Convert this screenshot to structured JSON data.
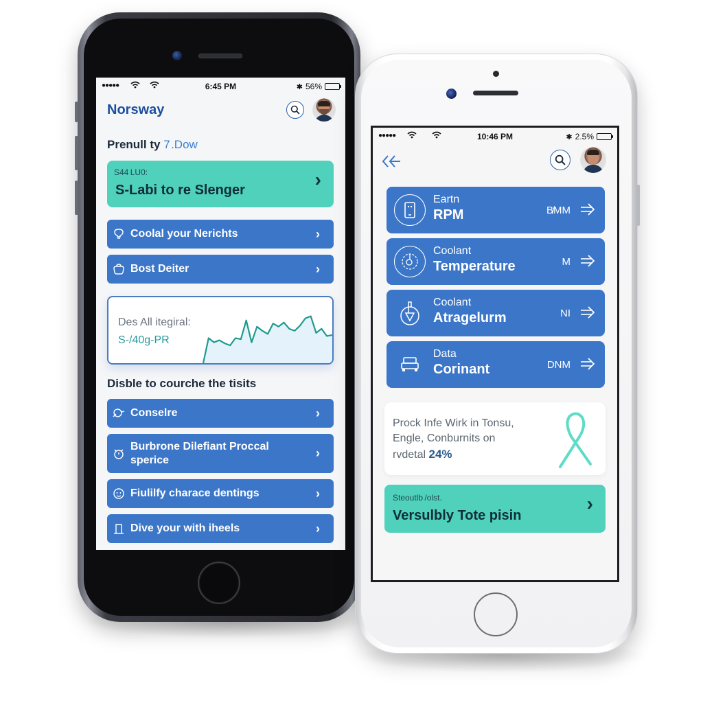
{
  "left_phone": {
    "status_bar": {
      "signal": "●●●●●",
      "time": "6:45 PM",
      "battery_percent": "56%",
      "battery_level": 0.56
    },
    "header": {
      "brand": "Norsway",
      "search_icon": "search-icon",
      "avatar": "user-avatar"
    },
    "subtitle": {
      "main": "Prenull ty",
      "accent": "7 .Dow"
    },
    "promo_card": {
      "small": "S44 LU0:",
      "title": "S-Labi to re Slenger",
      "chevron": "›"
    },
    "top_items": [
      {
        "icon": "lightbulb-icon",
        "label": "Coolal your Nerichts"
      },
      {
        "icon": "bag-icon",
        "label": "Bost Deiter"
      }
    ],
    "chart_card": {
      "title": "Des All itegiral:",
      "value": "S-/40g-PR"
    },
    "chart_data": {
      "type": "area",
      "title": "Des All itegiral:",
      "xlabel": "",
      "ylabel": "",
      "x": [
        0,
        1,
        2,
        3,
        4,
        5,
        6,
        7,
        8,
        9,
        10,
        11,
        12,
        13,
        14,
        15,
        16,
        17,
        18,
        19,
        20,
        21,
        22,
        23,
        24
      ],
      "values": [
        0,
        48,
        40,
        44,
        38,
        34,
        48,
        46,
        82,
        40,
        70,
        62,
        56,
        76,
        70,
        78,
        66,
        62,
        72,
        86,
        90,
        58,
        66,
        52,
        54
      ],
      "ylim": [
        0,
        100
      ],
      "grid": false,
      "line_color": "#1f9a8a",
      "fill_color": "#e4f2fb"
    },
    "section_title": "Disble to courche the tisits",
    "list_items": [
      {
        "icon": "pot-icon",
        "label": "Conselre"
      },
      {
        "icon": "alarm-clock-icon",
        "label": "Burbrone Dilefiant Proccal sperice"
      },
      {
        "icon": "face-icon",
        "label": "Fiulilfy charace dentings"
      },
      {
        "icon": "door-icon",
        "label": "Dive your with iheels"
      }
    ]
  },
  "right_phone": {
    "status_bar": {
      "signal": "●●●●●",
      "time": "10:46 PM",
      "battery_percent": "2.5%",
      "battery_level": 0.9
    },
    "header": {
      "back_icon": "double-chevron-left-icon",
      "search_icon": "search-icon",
      "avatar": "user-avatar"
    },
    "metrics": [
      {
        "icon": "phone-icon",
        "top": "Eartn",
        "bottom": "RPM",
        "unit": "B̸MM"
      },
      {
        "icon": "gauge-icon",
        "top": "Coolant",
        "bottom": "Temperature",
        "unit": "M"
      },
      {
        "icon": "thermometer-icon",
        "top": "Coolant",
        "bottom": "Atragelurm",
        "unit": "NI"
      },
      {
        "icon": "car-icon",
        "top": "Data",
        "bottom": "Corinant",
        "unit": "DNM"
      }
    ],
    "info_card": {
      "line1": "Prock Infe Wirk in Tonsu,",
      "line2": "Engle, Conburnits on",
      "line3_prefix": "rvdetal",
      "percent": "24%",
      "icon": "ribbon-icon"
    },
    "promo_card": {
      "small": "Steoutlb /olst.",
      "title": "Versulbly Tote pisin",
      "chevron": "›"
    }
  },
  "colors": {
    "primary_blue": "#3b76c8",
    "teal": "#4fd1bb",
    "brand_blue": "#1d4f9f"
  }
}
